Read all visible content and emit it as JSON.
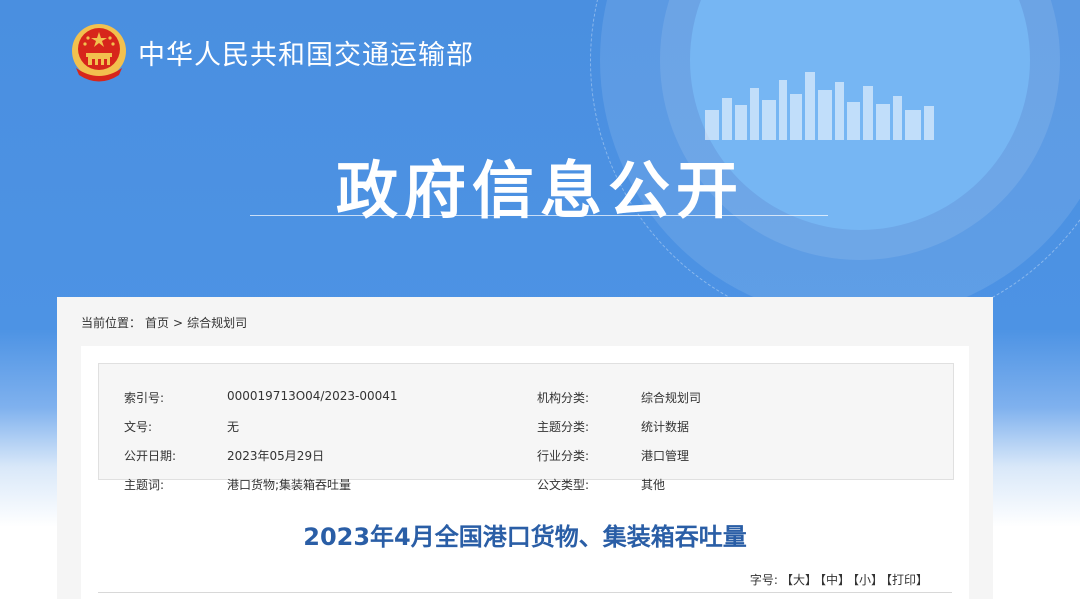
{
  "header": {
    "ministry_name": "中华人民共和国交通运输部",
    "section_title": "政府信息公开"
  },
  "breadcrumb": {
    "label": "当前位置：",
    "home": "首页",
    "separator": ">",
    "current": "综合规划司"
  },
  "meta": {
    "rows": [
      {
        "k1": "索引号:",
        "v1": "000019713O04/2023-00041",
        "k2": "机构分类:",
        "v2": "综合规划司"
      },
      {
        "k1": "文号:",
        "v1": "无",
        "k2": "主题分类:",
        "v2": "统计数据"
      },
      {
        "k1": "公开日期:",
        "v1": "2023年05月29日",
        "k2": "行业分类:",
        "v2": "港口管理"
      },
      {
        "k1": "主题词:",
        "v1": "港口货物;集装箱吞吐量",
        "k2": "公文类型:",
        "v2": "其他"
      }
    ]
  },
  "article": {
    "title": "2023年4月全国港口货物、集装箱吞吐量"
  },
  "font_size_controls": {
    "label": "字号:",
    "large": "【大】",
    "medium": "【中】",
    "small": "【小】",
    "print": "【打印】"
  },
  "colors": {
    "banner_blue": "#4a8fe0",
    "title_blue": "#2a5ea6",
    "emblem_red": "#d7261b",
    "emblem_gold": "#f2c14e"
  },
  "icons": {
    "emblem": "national-emblem-icon",
    "skyline": "city-skyline-decoration"
  }
}
